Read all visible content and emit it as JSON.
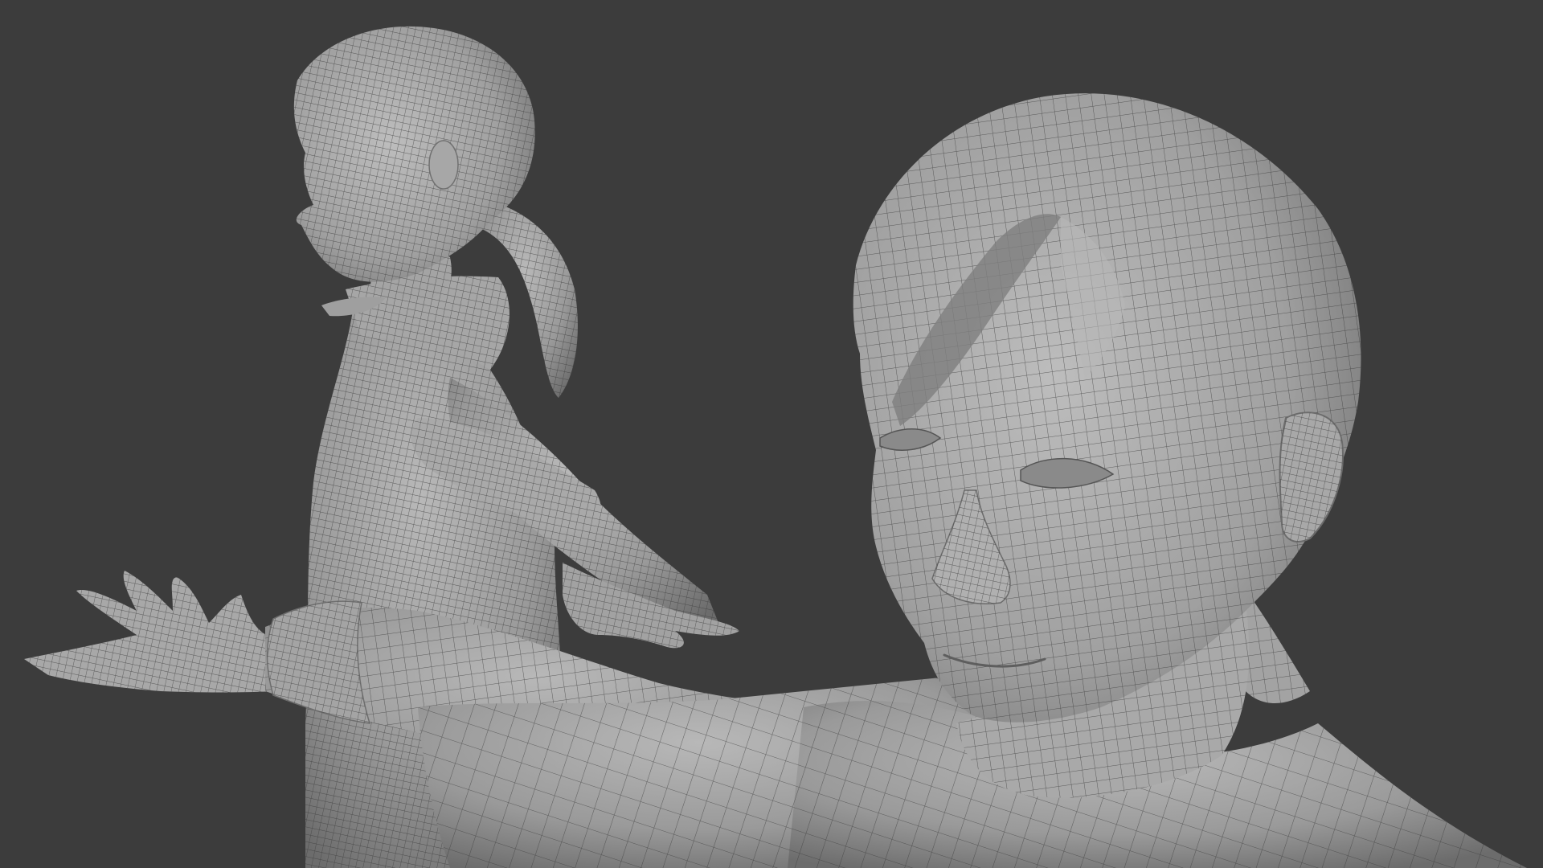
{
  "scene": {
    "description_visible_text": "",
    "colors": {
      "background": "#3c3c3c",
      "mesh_fill": "#9c9c9c",
      "mesh_light": "#b6b6b6",
      "mesh_shadow": "#6e6e6e",
      "wire": "#3a3a3a"
    }
  }
}
